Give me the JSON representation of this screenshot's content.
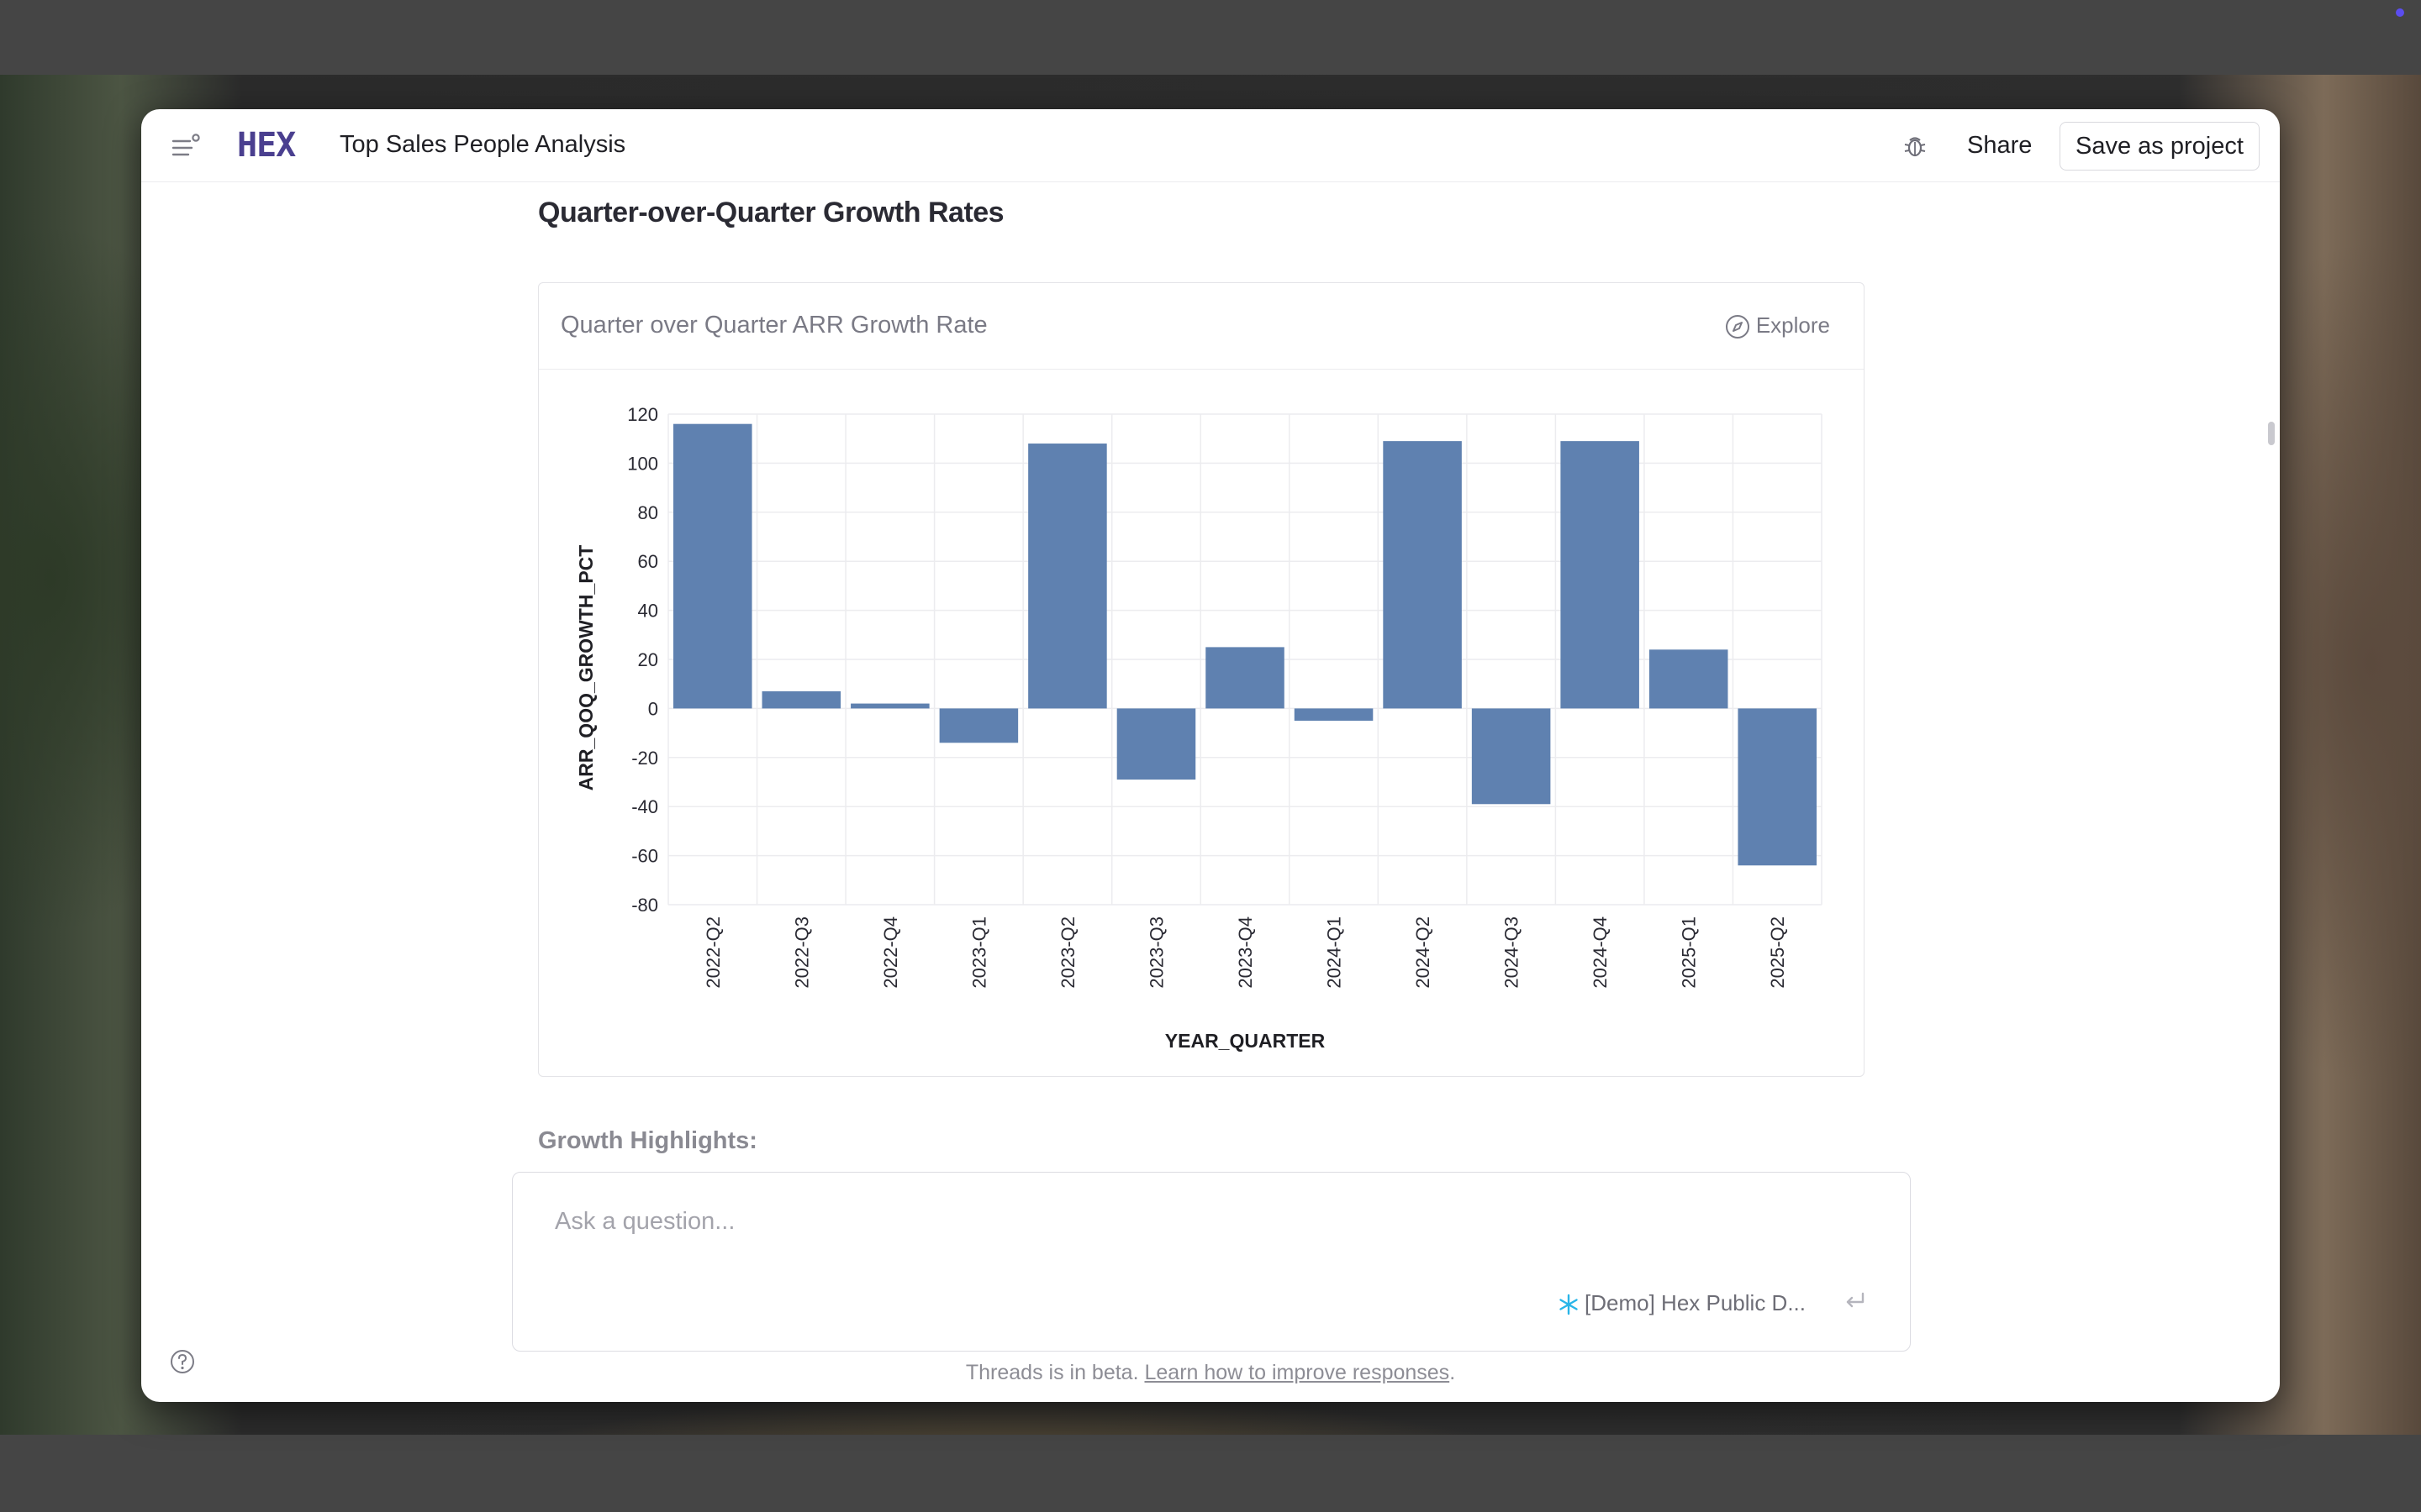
{
  "header": {
    "logo": "HEX",
    "title": "Top Sales People Analysis",
    "share_label": "Share",
    "save_label": "Save as project"
  },
  "section_title": "Quarter-over-Quarter Growth Rates",
  "chart_card": {
    "title": "Quarter over Quarter ARR Growth Rate",
    "explore_label": "Explore"
  },
  "chart_data": {
    "type": "bar",
    "title": "Quarter over Quarter ARR Growth Rate",
    "xlabel": "YEAR_QUARTER",
    "ylabel": "ARR_QOQ_GROWTH_PCT",
    "categories": [
      "2022-Q2",
      "2022-Q3",
      "2022-Q4",
      "2023-Q1",
      "2023-Q2",
      "2023-Q3",
      "2023-Q4",
      "2024-Q1",
      "2024-Q2",
      "2024-Q3",
      "2024-Q4",
      "2025-Q1",
      "2025-Q2"
    ],
    "values": [
      116,
      7,
      2,
      -14,
      108,
      -29,
      25,
      -5,
      109,
      -39,
      109,
      24,
      -64
    ],
    "ylim": [
      -80,
      120
    ],
    "yticks": [
      120,
      100,
      80,
      60,
      40,
      20,
      0,
      -20,
      -40,
      -60,
      -80
    ],
    "grid": true,
    "bar_color": "#5f81b0"
  },
  "growth_highlights": "Growth Highlights:",
  "composer": {
    "placeholder": "Ask a question...",
    "source_label": "[Demo] Hex Public D..."
  },
  "footnote": {
    "text": "Threads is in beta.",
    "link": "Learn how to improve responses",
    "suffix": "."
  }
}
